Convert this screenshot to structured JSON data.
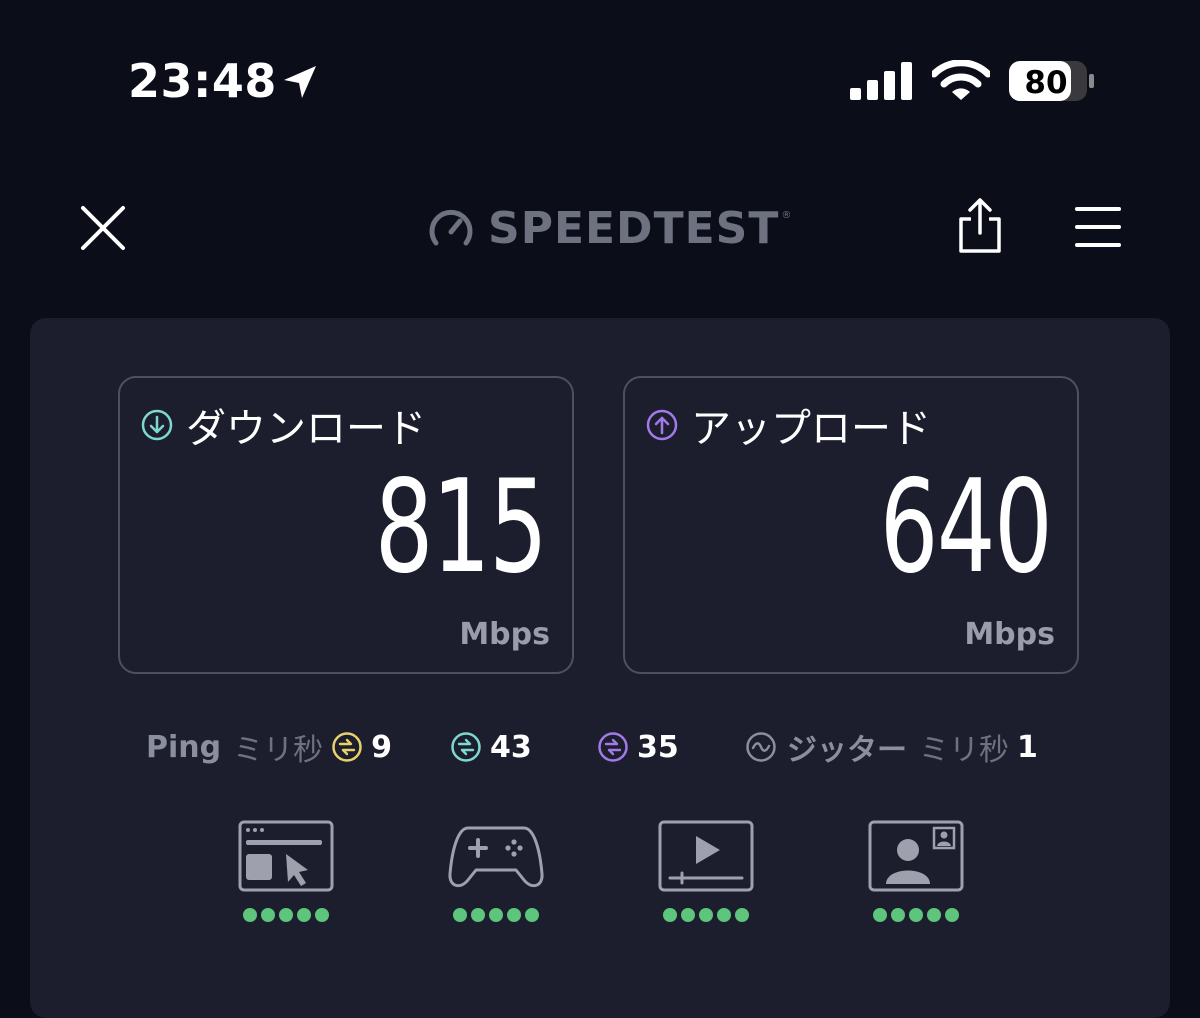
{
  "status_bar": {
    "time": "23:48",
    "battery": "80"
  },
  "header": {
    "brand": "SPEEDTEST",
    "brand_mark": "®"
  },
  "download": {
    "label": "ダウンロード",
    "value": "815",
    "unit": "Mbps",
    "color": "#7fd8d0"
  },
  "upload": {
    "label": "アップロード",
    "value": "640",
    "unit": "Mbps",
    "color": "#a279e8"
  },
  "ping": {
    "label": "Ping",
    "unit": "ミリ秒",
    "idle": "9",
    "download": "43",
    "upload": "35",
    "idle_color": "#e7d26a",
    "download_color": "#7fd8d0",
    "upload_color": "#a279e8"
  },
  "jitter": {
    "label": "ジッター",
    "unit": "ミリ秒",
    "value": "1"
  },
  "use_cases": [
    {
      "icon": "web-browsing-icon",
      "rating": 5
    },
    {
      "icon": "gaming-icon",
      "rating": 5
    },
    {
      "icon": "video-streaming-icon",
      "rating": 5
    },
    {
      "icon": "video-call-icon",
      "rating": 5
    }
  ],
  "colors": {
    "background": "#0b0d19",
    "card": "#1c1e2e",
    "rating_dot": "#5ec67c"
  }
}
